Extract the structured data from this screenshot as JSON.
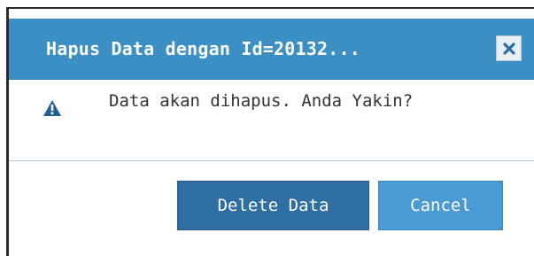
{
  "dialog": {
    "title": "Hapus Data dengan Id=20132...",
    "close_icon": "close-icon",
    "message_icon": "warning-icon",
    "message": "Data akan dihapus. Anda Yakin?",
    "buttons": {
      "delete_label": "Delete Data",
      "cancel_label": "Cancel"
    }
  },
  "colors": {
    "titlebar": "#3b8fc5",
    "delete_button": "#2f6ea3",
    "cancel_button": "#4a9bd4",
    "warning_icon": "#1f5f96"
  }
}
